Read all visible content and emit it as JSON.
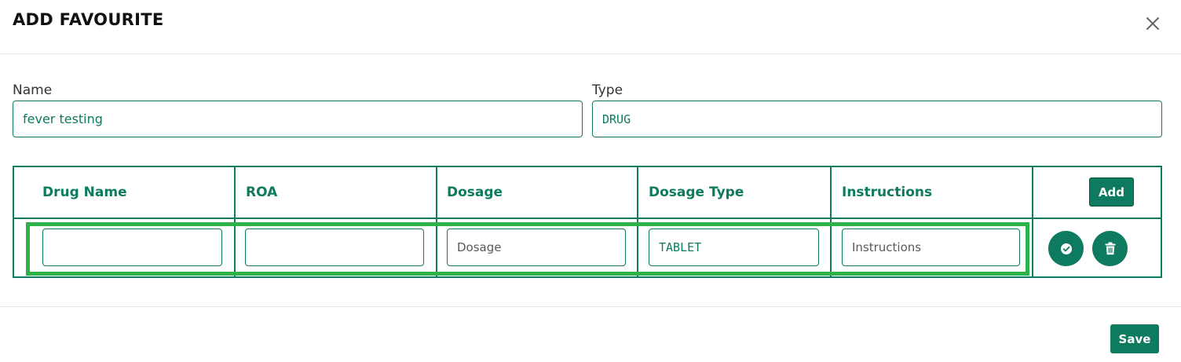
{
  "modal": {
    "title": "ADD FAVOURITE",
    "close_icon": "close-icon"
  },
  "form": {
    "name_label": "Name",
    "name_value": "fever testing",
    "type_label": "Type",
    "type_value": "DRUG"
  },
  "table": {
    "columns": [
      "Drug Name",
      "ROA",
      "Dosage",
      "Dosage Type",
      "Instructions"
    ],
    "add_label": "Add",
    "rows": [
      {
        "drug_name": "",
        "roa": "",
        "dosage_value": "",
        "dosage_placeholder": "Dosage",
        "dosage_type": "TABLET",
        "instructions_value": "",
        "instructions_placeholder": "Instructions",
        "confirm_icon": "check-circle-icon",
        "delete_icon": "trash-icon"
      }
    ]
  },
  "footer": {
    "save_label": "Save"
  },
  "colors": {
    "accent": "#0e7a5f",
    "highlight": "#2db24a"
  }
}
